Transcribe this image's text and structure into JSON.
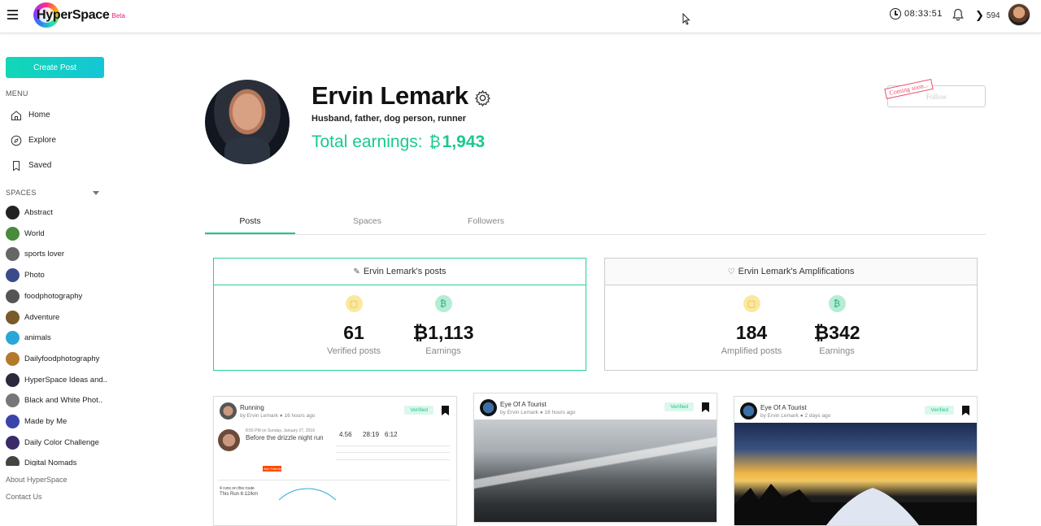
{
  "app": {
    "logo_text": "HyperSpace",
    "logo_badge": "Beta"
  },
  "topbar": {
    "clock": "08:33:51",
    "token_count": "594"
  },
  "sidebar": {
    "create_post": "Create Post",
    "menu_heading": "MENU",
    "menu": [
      {
        "label": "Home",
        "icon": "home-icon"
      },
      {
        "label": "Explore",
        "icon": "compass-icon"
      },
      {
        "label": "Saved",
        "icon": "bookmark-icon"
      }
    ],
    "spaces_heading": "SPACES",
    "spaces": [
      {
        "label": "Abstract",
        "color": "#222222"
      },
      {
        "label": "World",
        "color": "#4a8a3c"
      },
      {
        "label": "sports lover",
        "color": "#666666"
      },
      {
        "label": "Photo",
        "color": "#3b4b8a"
      },
      {
        "label": "foodphotography",
        "color": "#555555"
      },
      {
        "label": "Adventure",
        "color": "#7a5a2a"
      },
      {
        "label": "animals",
        "color": "#2aa7d6"
      },
      {
        "label": "Dailyfoodphotography",
        "color": "#b37a2a"
      },
      {
        "label": "HyperSpace Ideas and..",
        "color": "#2a2a3a"
      },
      {
        "label": "Black and White Phot..",
        "color": "#777777"
      },
      {
        "label": "Made by Me",
        "color": "#3a44a8"
      },
      {
        "label": "Daily Color Challenge",
        "color": "#3a2a6a"
      },
      {
        "label": "Digital Nomads",
        "color": "#444444"
      }
    ],
    "footer": [
      "About HyperSpace",
      "Contact Us"
    ]
  },
  "profile": {
    "name": "Ervin Lemark",
    "bio": "Husband, father, dog person, runner",
    "earnings_label": "Total earnings:",
    "earnings_symbol": "₿",
    "earnings_amount": "1,943",
    "follow_label": "Follow",
    "coming_soon": "Coming soon..."
  },
  "tabs": [
    "Posts",
    "Spaces",
    "Followers"
  ],
  "stats": {
    "posts": {
      "title": "Ervin Lemark's posts",
      "items": [
        {
          "value": "61",
          "label": "Verified posts"
        },
        {
          "value": "₿1,113",
          "label": "Earnings"
        }
      ]
    },
    "amplifications": {
      "title": "Ervin Lemark's Amplifications",
      "items": [
        {
          "value": "184",
          "label": "Amplified posts"
        },
        {
          "value": "₿342",
          "label": "Earnings"
        }
      ]
    }
  },
  "posts": [
    {
      "title": "Running",
      "author": "by Ervin Lemark",
      "time": "16 hours ago",
      "badge": "Verified"
    },
    {
      "title": "Eye Of A Tourist",
      "author": "by Ervin Lemark",
      "time": "16 hours ago",
      "badge": "Verified"
    },
    {
      "title": "Eye Of A Tourist",
      "author": "by Ervin Lemark",
      "time": "2 days ago",
      "badge": "Verified"
    }
  ],
  "strava_snippet": {
    "date": "8:55 PM on Sunday, January 27, 2019",
    "title": "Before the drizzle night run",
    "distance": "4.56",
    "time": "28:19",
    "pace": "6:12",
    "button": "Join Friends",
    "footer": "4 runs on this route",
    "footer_pace": "This Run 6:12/km"
  }
}
